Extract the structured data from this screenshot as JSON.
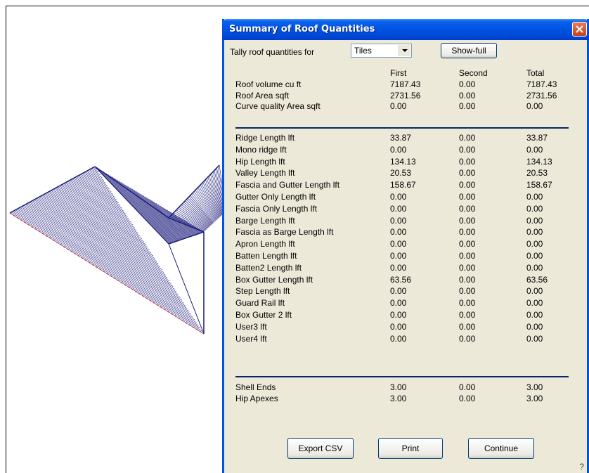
{
  "dialog": {
    "title": "Summary of Roof Quantities",
    "tally_label": "Tally roof quantities for",
    "tally_value": "Tiles",
    "show_full_label": "Show-full",
    "columns": [
      "First",
      "Second",
      "Total"
    ],
    "group1": [
      {
        "name": "Roof volume cu ft",
        "first": "7187.43",
        "second": "0.00",
        "total": "7187.43"
      },
      {
        "name": "Roof Area sqft",
        "first": "2731.56",
        "second": "0.00",
        "total": "2731.56"
      },
      {
        "name": "Curve quality Area sqft",
        "first": "0.00",
        "second": "0.00",
        "total": "0.00"
      }
    ],
    "group2": [
      {
        "name": "Ridge Length lft",
        "first": "33.87",
        "second": "0.00",
        "total": "33.87"
      },
      {
        "name": "Mono ridge lft",
        "first": "0.00",
        "second": "0.00",
        "total": "0.00"
      },
      {
        "name": "Hip Length lft",
        "first": "134.13",
        "second": "0.00",
        "total": "134.13"
      },
      {
        "name": "Valley Length lft",
        "first": "20.53",
        "second": "0.00",
        "total": "20.53"
      },
      {
        "name": "Fascia and Gutter Length lft",
        "first": "158.67",
        "second": "0.00",
        "total": "158.67"
      },
      {
        "name": "Gutter Only Length lft",
        "first": "0.00",
        "second": "0.00",
        "total": "0.00"
      },
      {
        "name": "Fascia Only Length lft",
        "first": "0.00",
        "second": "0.00",
        "total": "0.00"
      },
      {
        "name": "Barge Length lft",
        "first": "0.00",
        "second": "0.00",
        "total": "0.00"
      },
      {
        "name": "Fascia as Barge Length lft",
        "first": "0.00",
        "second": "0.00",
        "total": "0.00"
      },
      {
        "name": "Apron Length lft",
        "first": "0.00",
        "second": "0.00",
        "total": "0.00"
      },
      {
        "name": "Batten Length lft",
        "first": "0.00",
        "second": "0.00",
        "total": "0.00"
      },
      {
        "name": "Batten2 Length lft",
        "first": "0.00",
        "second": "0.00",
        "total": "0.00"
      },
      {
        "name": "Box Gutter Length lft",
        "first": "63.56",
        "second": "0.00",
        "total": "63.56"
      },
      {
        "name": "Step Length lft",
        "first": "0.00",
        "second": "0.00",
        "total": "0.00"
      },
      {
        "name": "Guard Rail lft",
        "first": "0.00",
        "second": "0.00",
        "total": "0.00"
      },
      {
        "name": "Box Gutter 2 lft",
        "first": "0.00",
        "second": "0.00",
        "total": "0.00"
      },
      {
        "name": "User3 lft",
        "first": "0.00",
        "second": "0.00",
        "total": "0.00"
      },
      {
        "name": "User4 lft",
        "first": "0.00",
        "second": "0.00",
        "total": "0.00"
      }
    ],
    "group3": [
      {
        "name": "Shell Ends",
        "first": "3.00",
        "second": "0.00",
        "total": "3.00"
      },
      {
        "name": "Hip Apexes",
        "first": "3.00",
        "second": "0.00",
        "total": "3.00"
      }
    ],
    "buttons": {
      "export_csv": "Export CSV",
      "print": "Print",
      "continue": "Continue"
    },
    "help_glyph": "?"
  },
  "colors": {
    "title_bar": "#0054e3",
    "dialog_bg": "#ece9d8",
    "separator": "#0a246a",
    "roof_lines": "#1a1a7a",
    "eave_dash": "#cc3344"
  },
  "icons": [
    "close-icon",
    "dropdown-arrow-icon"
  ]
}
